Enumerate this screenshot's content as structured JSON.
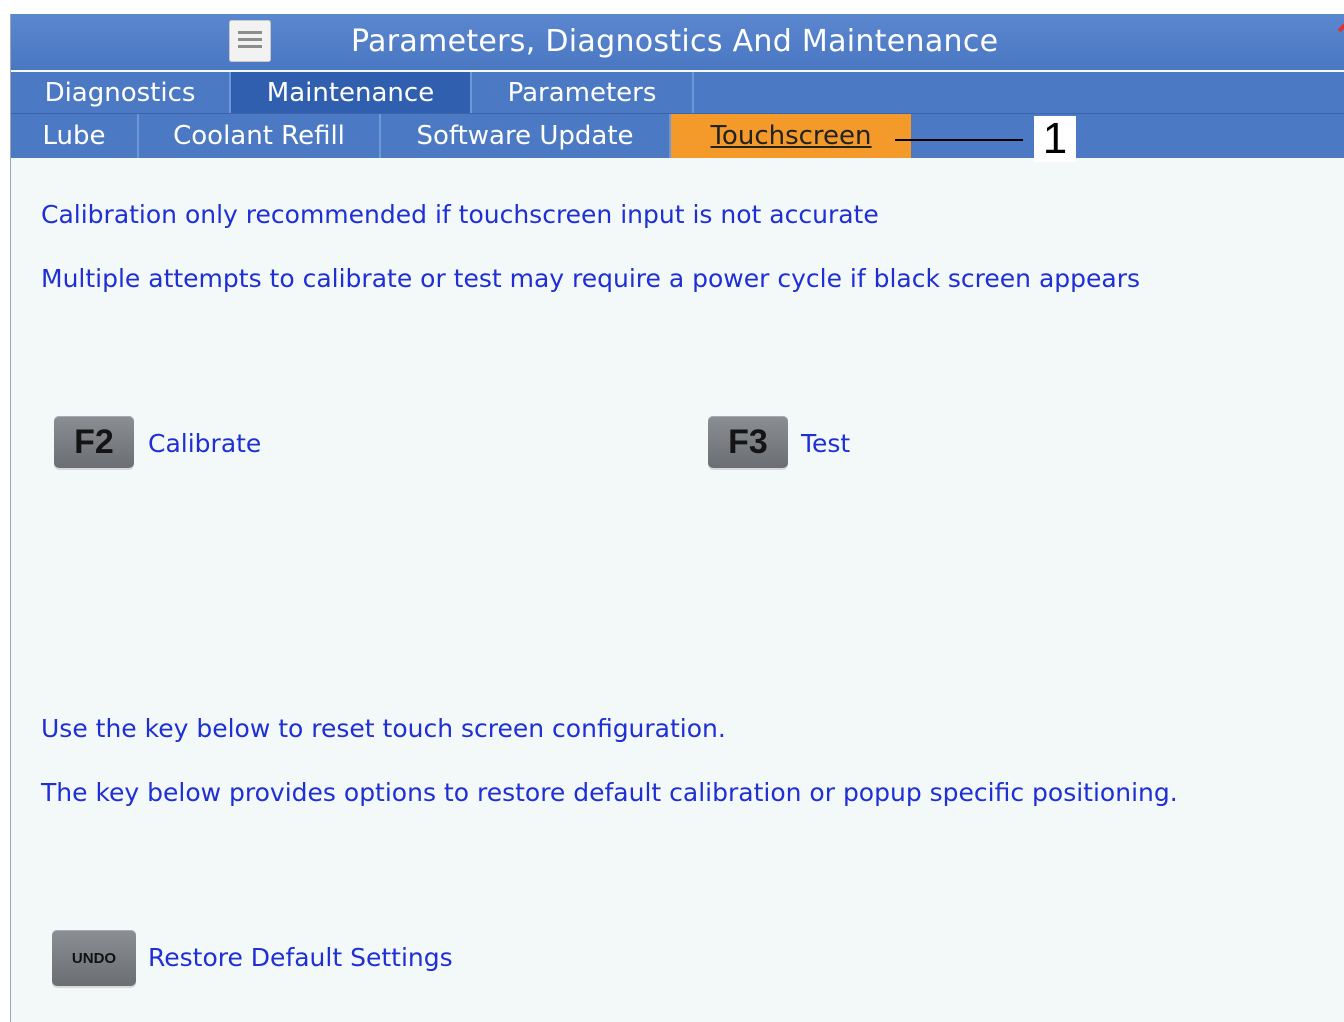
{
  "window": {
    "title": "Parameters, Diagnostics And Maintenance"
  },
  "tabs_primary": [
    {
      "label": "Diagnostics",
      "selected": false
    },
    {
      "label": "Maintenance",
      "selected": true
    },
    {
      "label": "Parameters",
      "selected": false
    }
  ],
  "tabs_secondary": [
    {
      "label": "Lube",
      "selected": false
    },
    {
      "label": "Coolant Refill",
      "selected": false
    },
    {
      "label": "Software Update",
      "selected": false
    },
    {
      "label": "Touchscreen",
      "selected": true
    }
  ],
  "callout": {
    "number": "1"
  },
  "content": {
    "line1": "Calibration only recommended if touchscreen input is not accurate",
    "line2": "Multiple attempts to calibrate or test may require a power cycle if black screen appears",
    "calibrate": {
      "key": "F2",
      "label": "Calibrate"
    },
    "test": {
      "key": "F3",
      "label": "Test"
    },
    "line3": "Use the key below to reset touch screen configuration.",
    "line4": "The key below provides options to restore default calibration or popup specific positioning.",
    "restore": {
      "key": "UNDO",
      "label": "Restore Default Settings"
    }
  },
  "colors": {
    "header_blue": "#4c79c4",
    "selected_tab": "#2f5fae",
    "accent_orange": "#f39a2b",
    "text_blue": "#1f2fd6"
  },
  "icons": [
    "menu-icon"
  ]
}
